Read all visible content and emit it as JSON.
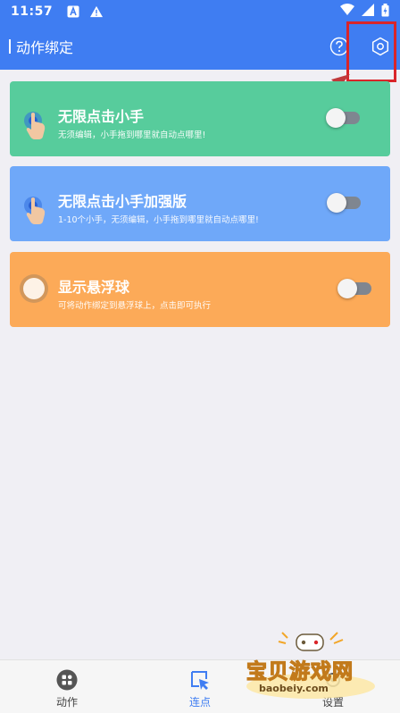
{
  "status_bar": {
    "time": "11:57"
  },
  "app_bar": {
    "title": "动作绑定"
  },
  "cards": [
    {
      "title": "无限点击小手",
      "desc": "无须编辑，小手拖到哪里就自动点哪里!",
      "color": "#57cc9c",
      "enabled": false
    },
    {
      "title": "无限点击小手加强版",
      "desc": "1-10个小手，无须编辑，小手拖到哪里就自动点哪里!",
      "color": "#6fa8f9",
      "enabled": false
    },
    {
      "title": "显示悬浮球",
      "desc": "可将动作绑定到悬浮球上，点击即可执行",
      "color": "#fcaa58",
      "enabled": false
    }
  ],
  "bottom_nav": [
    {
      "label": "动作",
      "active": false
    },
    {
      "label": "连点",
      "active": true
    },
    {
      "label": "设置",
      "active": false
    }
  ],
  "watermark": {
    "title": "宝贝游戏网",
    "url": "baobeiy.com"
  },
  "colors": {
    "primary": "#3f7df2",
    "highlight": "#d9252a"
  }
}
